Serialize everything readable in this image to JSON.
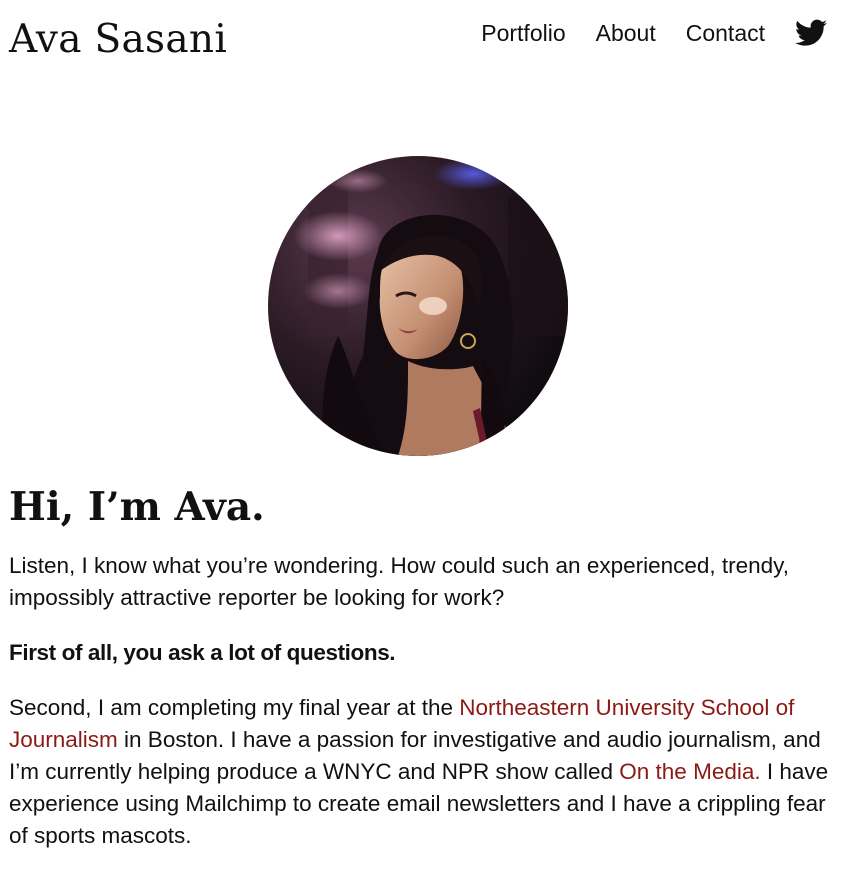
{
  "header": {
    "site_title": "Ava Sasani",
    "nav": [
      {
        "label": "Portfolio"
      },
      {
        "label": "About"
      },
      {
        "label": "Contact"
      }
    ],
    "social_icon": "twitter-icon"
  },
  "profile_photo": {
    "alt": "Ava Sasani"
  },
  "main": {
    "greeting": "Hi, I’m Ava.",
    "intro": "Listen, I know what you’re wondering. How could such an experienced, trendy, impossibly attractive reporter be looking for work?",
    "emphasis": "First of all, you ask a lot of questions.",
    "bio": {
      "part1": "Second, I am completing my final year at the ",
      "link1": "Northeastern University School of Journalism",
      "part2": " in Boston. I have a passion for investigative and audio journalism, and I’m currently helping produce a WNYC and NPR show called ",
      "link2": "On the Media.",
      "part3": " I have experience using Mailchimp to create email newsletters and I have a crippling fear of sports mascots."
    }
  },
  "colors": {
    "text": "#111111",
    "link": "#8b1a14",
    "background": "#ffffff"
  }
}
